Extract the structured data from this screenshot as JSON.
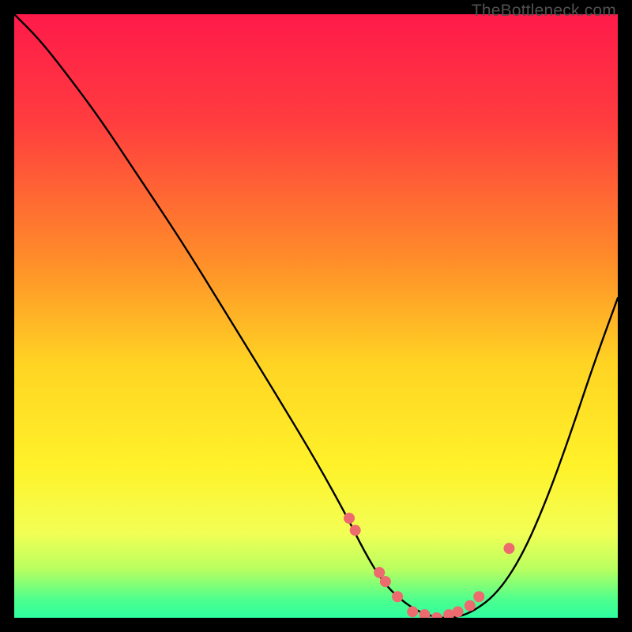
{
  "attribution": "TheBottleneck.com",
  "chart_data": {
    "type": "line",
    "title": "",
    "xlabel": "",
    "ylabel": "",
    "xlim": [
      0,
      100
    ],
    "ylim": [
      0,
      100
    ],
    "gradient_stops": [
      {
        "offset": 0,
        "color": "#ff1a4a"
      },
      {
        "offset": 18,
        "color": "#ff3d3f"
      },
      {
        "offset": 40,
        "color": "#ff8a2a"
      },
      {
        "offset": 58,
        "color": "#ffd423"
      },
      {
        "offset": 75,
        "color": "#fff22a"
      },
      {
        "offset": 86,
        "color": "#f2ff55"
      },
      {
        "offset": 92,
        "color": "#b8ff60"
      },
      {
        "offset": 97,
        "color": "#4dff8d"
      },
      {
        "offset": 100,
        "color": "#2dffa0"
      }
    ],
    "series": [
      {
        "name": "bottleneck-curve",
        "x": [
          0,
          4,
          8,
          14,
          20,
          28,
          36,
          44,
          50,
          55,
          58,
          61,
          64,
          67,
          70,
          73,
          76,
          80,
          84,
          88,
          92,
          96,
          100
        ],
        "y": [
          100,
          96,
          91,
          83,
          74,
          62,
          49,
          36,
          26,
          17,
          11,
          6,
          3,
          1,
          0,
          0,
          1,
          4,
          10,
          19,
          30,
          42,
          53
        ]
      }
    ],
    "markers": {
      "name": "optimal-points",
      "color": "#ed6a6e",
      "radius": 7,
      "x": [
        55.5,
        56.5,
        60.5,
        61.5,
        63.5,
        66,
        68,
        70,
        72,
        73.5,
        75.5,
        77,
        82
      ],
      "y": [
        16.5,
        14.5,
        7.5,
        6,
        3.5,
        1,
        0.5,
        0,
        0.5,
        1,
        2,
        3.5,
        11.5
      ]
    }
  }
}
